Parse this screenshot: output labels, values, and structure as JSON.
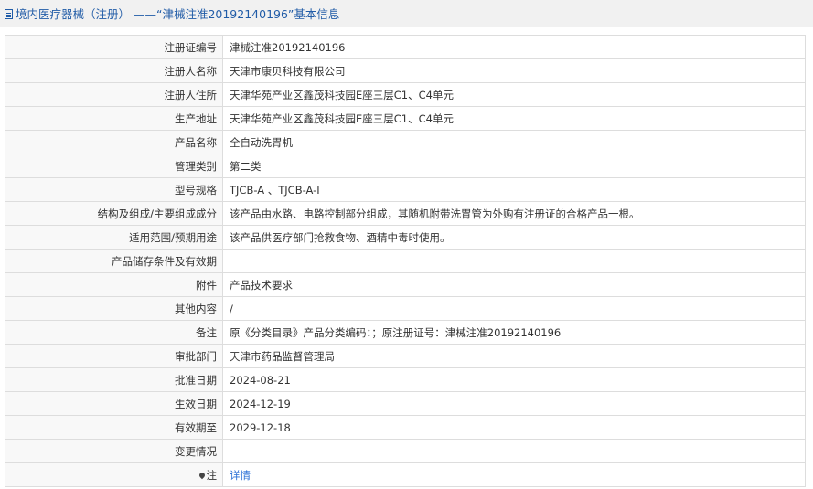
{
  "header": {
    "title": "境内医疗器械（注册） ——“津械注准20192140196”基本信息",
    "icon": "document-icon"
  },
  "rows": [
    {
      "label": "注册证编号",
      "value": "津械注准20192140196"
    },
    {
      "label": "注册人名称",
      "value": "天津市康贝科技有限公司"
    },
    {
      "label": "注册人住所",
      "value": "天津华苑产业区鑫茂科技园E座三层C1、C4单元"
    },
    {
      "label": "生产地址",
      "value": "天津华苑产业区鑫茂科技园E座三层C1、C4单元"
    },
    {
      "label": "产品名称",
      "value": "全自动洗胃机"
    },
    {
      "label": "管理类别",
      "value": "第二类"
    },
    {
      "label": "型号规格",
      "value": "TJCB-A 、TJCB-A-I"
    },
    {
      "label": "结构及组成/主要组成成分",
      "value": "该产品由水路、电路控制部分组成，其随机附带洗胃管为外购有注册证的合格产品一根。"
    },
    {
      "label": "适用范围/预期用途",
      "value": "该产品供医疗部门抢救食物、酒精中毒时使用。"
    },
    {
      "label": "产品储存条件及有效期",
      "value": ""
    },
    {
      "label": "附件",
      "value": "产品技术要求"
    },
    {
      "label": "其他内容",
      "value": "/"
    },
    {
      "label": "备注",
      "value": "原《分类目录》产品分类编码：；原注册证号：津械注准20192140196"
    },
    {
      "label": "审批部门",
      "value": "天津市药品监督管理局"
    },
    {
      "label": "批准日期",
      "value": "2024-08-21"
    },
    {
      "label": "生效日期",
      "value": "2024-12-19"
    },
    {
      "label": "有效期至",
      "value": "2029-12-18"
    },
    {
      "label": "变更情况",
      "value": ""
    }
  ],
  "note_row": {
    "label": "注",
    "icon": "pin-icon",
    "link_text": "详情"
  },
  "colors": {
    "title": "#215ca7",
    "label_bg": "#f8f8f8",
    "border": "#dddddd",
    "link": "#2a6fd6"
  }
}
